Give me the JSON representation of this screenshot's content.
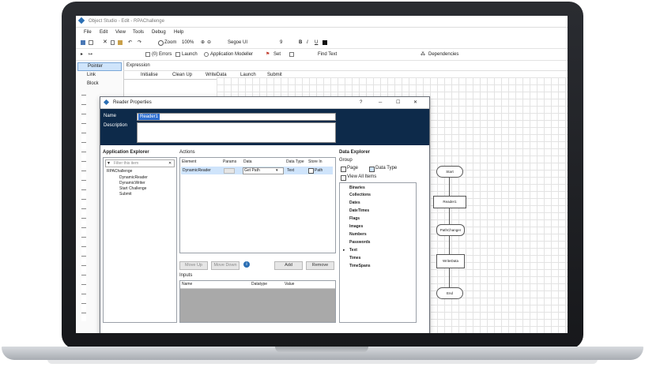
{
  "app": {
    "title": "Object Studio - Edit - RPAChallenge",
    "menu": [
      "File",
      "Edit",
      "View",
      "Tools",
      "Debug",
      "Help"
    ]
  },
  "toolbar1": {
    "zoom_label": "Zoom",
    "zoom_value": "100%",
    "font_name": "Segoe UI",
    "font_size": "9",
    "bold": "B",
    "italic": "I",
    "underline": "U"
  },
  "toolbar2": {
    "errors_label": "(0) Errors",
    "launch_label": "Launch",
    "app_modeller_label": "Application Modeller",
    "set_label": "Set",
    "find_text_label": "Find Text",
    "dependencies_label": "Dependencies"
  },
  "left_tools": {
    "items": [
      "Pointer",
      "Link",
      "Block"
    ]
  },
  "expression_label": "Expression",
  "page_tabs": [
    "Initialise",
    "Clean Up",
    "WriteData",
    "Launch",
    "Submit"
  ],
  "dialog": {
    "title": "Reader Properties",
    "help": "?",
    "name_label": "Name",
    "name_value": "Reader1",
    "description_label": "Description",
    "app_explorer": {
      "title": "Application Explorer",
      "filter_placeholder": "Filter this item",
      "root": "RPAChallenge",
      "children": [
        "DynamicReader",
        "DynamicWriter",
        "Start Challenge",
        "Submit"
      ]
    },
    "actions": {
      "title": "Actions",
      "columns": [
        "Element",
        "Params",
        "Data",
        "Data Type",
        "Store In"
      ],
      "row": {
        "element": "DynamicReader",
        "params": "",
        "data": "Get Path",
        "datatype": "Text",
        "store_in": "Path"
      },
      "move_up": "Move Up",
      "move_down": "Move Down",
      "add": "Add",
      "remove": "Remove"
    },
    "inputs": {
      "title": "Inputs",
      "columns": [
        "Name",
        "Datatype",
        "Value"
      ]
    },
    "data_explorer": {
      "title": "Data Explorer",
      "group_label": "Group",
      "page_label": "Page",
      "datatype_label": "Data Type",
      "view_all_label": "View All Items",
      "items": [
        "Binaries",
        "Collections",
        "Dates",
        "DateTimes",
        "Flags",
        "Images",
        "Numbers",
        "Passwords",
        "Text",
        "Times",
        "TimeSpans"
      ]
    }
  },
  "flow": {
    "start": "Start",
    "reader": "Reader1",
    "step2": "PathChanger",
    "step3": "WriteData",
    "end": "End"
  },
  "colors": {
    "dialog_header": "#0d2a4a",
    "selection": "#cfe4fb",
    "bezel": "#1f2125"
  }
}
